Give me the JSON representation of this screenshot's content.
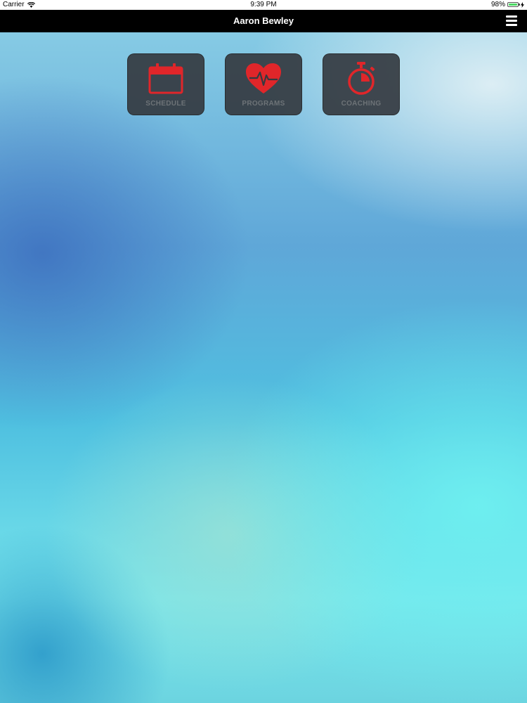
{
  "status_bar": {
    "carrier": "Carrier",
    "time": "9:39 PM",
    "battery_percent": "98%",
    "battery_level": 0.98,
    "wifi_icon": "wifi-icon",
    "charging_icon": "charging-bolt-icon"
  },
  "nav": {
    "title": "Aaron Bewley",
    "menu_icon": "hamburger-menu-icon"
  },
  "tiles": [
    {
      "label": "SCHEDULE",
      "icon": "calendar-icon"
    },
    {
      "label": "PROGRAMS",
      "icon": "heart-pulse-icon"
    },
    {
      "label": "COACHING",
      "icon": "stopwatch-icon"
    }
  ],
  "colors": {
    "icon_red": "#e0262a",
    "tile_background": "#343a40",
    "nav_background": "#000000",
    "tile_label": "#6d7377"
  }
}
